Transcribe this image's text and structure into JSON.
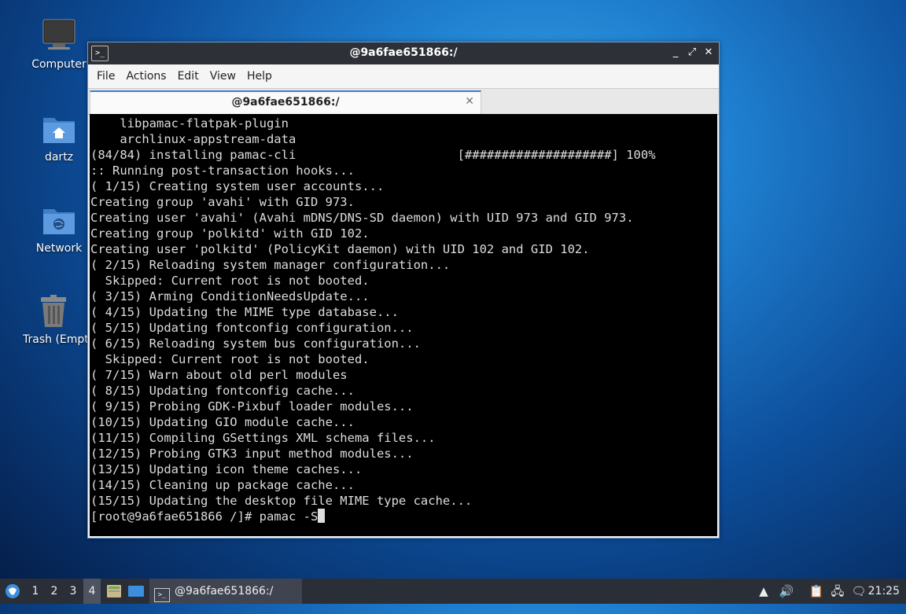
{
  "desktop": {
    "icons": [
      {
        "label": "Computer",
        "icon": "computer-icon"
      },
      {
        "label": "dartz",
        "icon": "home-folder-icon"
      },
      {
        "label": "Network",
        "icon": "network-folder-icon"
      },
      {
        "label": "Trash (Empty)",
        "icon": "trash-icon"
      }
    ]
  },
  "window": {
    "title": "@9a6fae651866:/",
    "app_icon_glyph": ">_",
    "controls": {
      "minimize": "_",
      "maximize": "⤢",
      "close": "✕"
    },
    "menu": [
      "File",
      "Actions",
      "Edit",
      "View",
      "Help"
    ],
    "tab": {
      "label": "@9a6fae651866:/",
      "close": "✕"
    }
  },
  "terminal": {
    "lines": [
      "    libpamac-flatpak-plugin",
      "    archlinux-appstream-data",
      "(84/84) installing pamac-cli                      [####################] 100%",
      ":: Running post-transaction hooks...",
      "( 1/15) Creating system user accounts...",
      "Creating group 'avahi' with GID 973.",
      "Creating user 'avahi' (Avahi mDNS/DNS-SD daemon) with UID 973 and GID 973.",
      "Creating group 'polkitd' with GID 102.",
      "Creating user 'polkitd' (PolicyKit daemon) with UID 102 and GID 102.",
      "( 2/15) Reloading system manager configuration...",
      "  Skipped: Current root is not booted.",
      "( 3/15) Arming ConditionNeedsUpdate...",
      "( 4/15) Updating the MIME type database...",
      "( 5/15) Updating fontconfig configuration...",
      "( 6/15) Reloading system bus configuration...",
      "  Skipped: Current root is not booted.",
      "( 7/15) Warn about old perl modules",
      "( 8/15) Updating fontconfig cache...",
      "( 9/15) Probing GDK-Pixbuf loader modules...",
      "(10/15) Updating GIO module cache...",
      "(11/15) Compiling GSettings XML schema files...",
      "(12/15) Probing GTK3 input method modules...",
      "(13/15) Updating icon theme caches...",
      "(14/15) Cleaning up package cache...",
      "(15/15) Updating the desktop file MIME type cache..."
    ],
    "prompt": "[root@9a6fae651866 /]# pamac -S"
  },
  "taskbar": {
    "workspaces": [
      "1",
      "2",
      "3",
      "4"
    ],
    "active_workspace": "4",
    "task_label": "@9a6fae651866:/",
    "clock": "21:25"
  }
}
